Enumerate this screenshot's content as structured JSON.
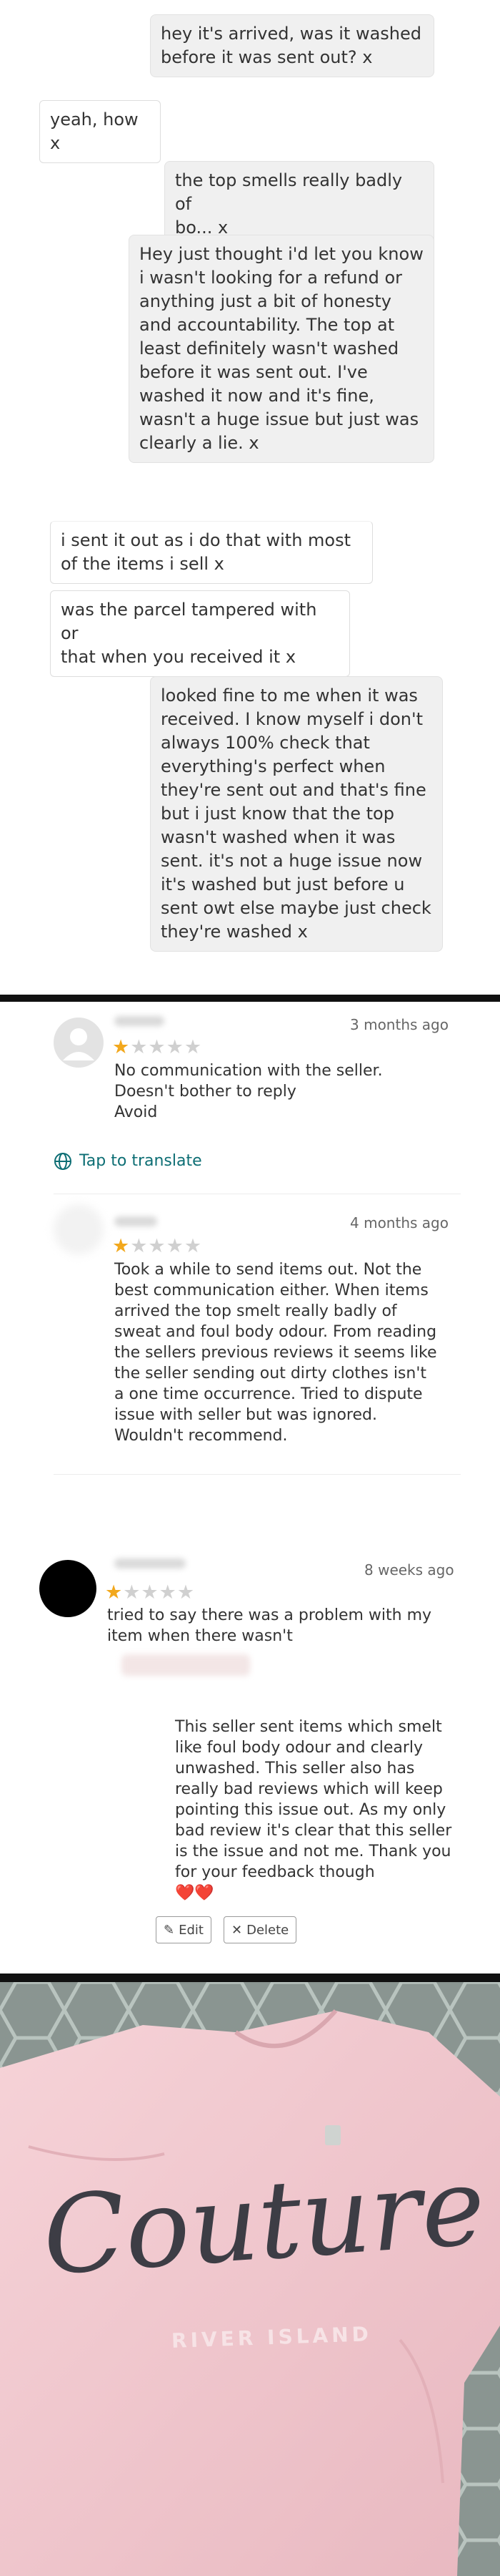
{
  "chat": {
    "messages": [
      {
        "from": "me",
        "text": "hey it's arrived, was it washed\nbefore it was sent out? x"
      },
      {
        "from": "them",
        "text": "yeah, how x"
      },
      {
        "from": "me",
        "text": "the top smells really badly of\nbo... x"
      },
      {
        "from": "me",
        "text": "Hey just thought i'd let you know\ni wasn't looking for a refund or\nanything just a bit of honesty\nand accountability. The top at\nleast definitely wasn't washed\nbefore it was sent out. I've\nwashed it now and it's fine,\nwasn't a huge issue but just was\nclearly a lie. x"
      },
      {
        "from": "them",
        "text": "i sent it out as i do that with most\nof the items i sell x"
      },
      {
        "from": "them",
        "text": "was the parcel tampered with or\nthat when you received it x"
      },
      {
        "from": "me",
        "text": "looked fine to me when it was\nreceived. I know myself i don't\nalways 100% check that\neverything's perfect when\nthey're sent out and that's fine\nbut i just know that the top\nwasn't washed when it was\nsent. it's not a huge issue now\nit's washed but just before u\nsent owt else maybe just check\nthey're washed x"
      }
    ]
  },
  "reviews": [
    {
      "date": "3 months ago",
      "rating": 1,
      "max_rating": 5,
      "text": "No communication with the seller.\nDoesn't bother to reply\nAvoid",
      "translate_label": "Tap to translate"
    },
    {
      "date": "4 months ago",
      "rating": 1,
      "max_rating": 5,
      "text": "Took a while to send items out. Not the\nbest communication either. When items\narrived the top smelt really badly of\nsweat and foul body odour. From reading\nthe sellers previous reviews it seems like\nthe seller sending out dirty clothes isn't\na one time occurrence. Tried to dispute\nissue with seller but was ignored.\nWouldn't recommend."
    },
    {
      "date": "8 weeks ago",
      "rating": 1,
      "max_rating": 5,
      "text": "tried to say there was a problem with my\nitem when there wasn't",
      "reply": "This seller sent items which smelt\nlike foul body odour and clearly\nunwashed. This seller also has\nreally bad reviews which will keep\npointing this issue out. As my only\nbad review it's clear that this seller\nis the issue and not me. Thank you\nfor your feedback though",
      "reply_emoji": "❤️❤️",
      "edit_label": "Edit",
      "delete_label": "Delete"
    }
  ],
  "photo": {
    "logo_text": "Couture",
    "brand_text": "RIVER ISLAND"
  },
  "colors": {
    "star_filled": "#f2a81d",
    "star_empty": "#d0d0d0",
    "translate": "#0d6e74",
    "shirt": "#f2c9cf",
    "rug": "#7f8b87"
  },
  "icons": [
    "user-avatar-icon",
    "globe-icon",
    "pencil-icon",
    "close-icon",
    "heart-icon"
  ]
}
